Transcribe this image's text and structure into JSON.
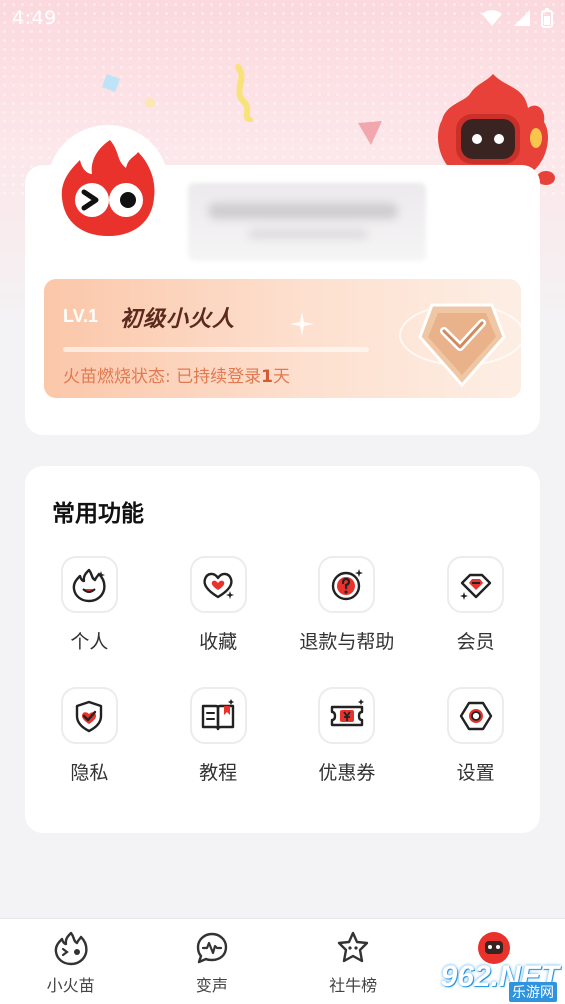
{
  "status_bar": {
    "time": "4:49"
  },
  "profile": {
    "level_tag": "LV.1",
    "level_name": "初级小火人",
    "status_prefix": "火苗燃烧状态: 已持续登录",
    "status_days": "1",
    "status_suffix": "天",
    "level_progress": 0
  },
  "functions": {
    "title": "常用功能",
    "items": [
      {
        "label": "个人",
        "icon": "flame-face-icon"
      },
      {
        "label": "收藏",
        "icon": "heart-icon"
      },
      {
        "label": "退款与帮助",
        "icon": "question-icon"
      },
      {
        "label": "会员",
        "icon": "gem-icon"
      },
      {
        "label": "隐私",
        "icon": "shield-check-icon"
      },
      {
        "label": "教程",
        "icon": "book-icon"
      },
      {
        "label": "优惠券",
        "icon": "coupon-icon"
      },
      {
        "label": "设置",
        "icon": "hexagon-settings-icon"
      }
    ]
  },
  "bottom_nav": [
    {
      "label": "小火苗",
      "icon": "flame-face-icon"
    },
    {
      "label": "变声",
      "icon": "voice-wave-icon"
    },
    {
      "label": "社牛榜",
      "icon": "star-face-icon"
    },
    {
      "label": "",
      "icon": "mascot-avatar-icon"
    }
  ],
  "watermark": {
    "text": "962.NET",
    "sub": "乐游网"
  },
  "colors": {
    "accent": "#e8322b",
    "level_text": "#5a2a1e",
    "level_status": "#e07a52"
  }
}
